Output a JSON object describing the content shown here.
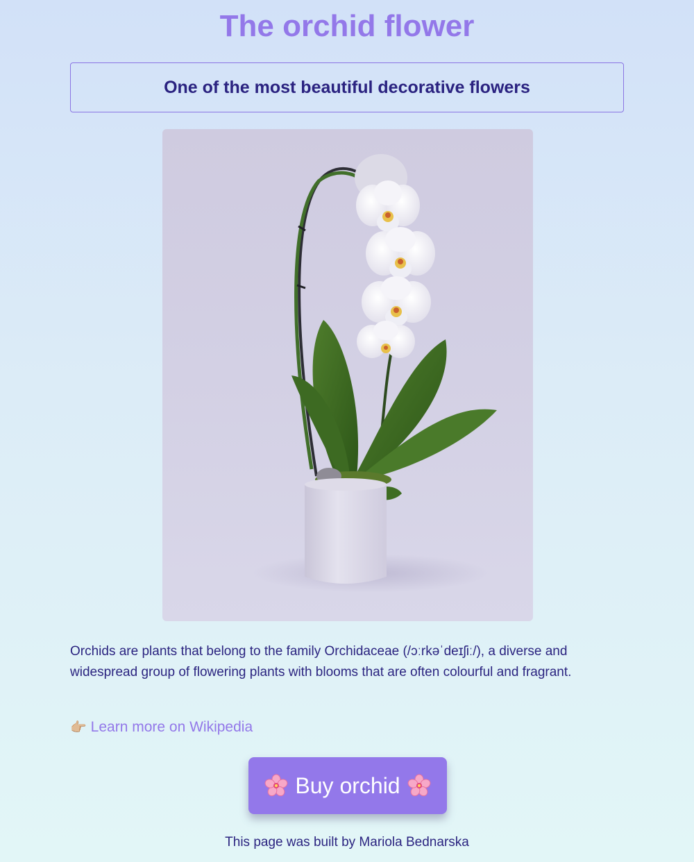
{
  "header": {
    "title": "The orchid flower",
    "subtitle": "One of the most beautiful decorative flowers"
  },
  "image": {
    "alt": "White orchid in a pot",
    "icon": "orchid-photo"
  },
  "main": {
    "description": "Orchids are plants that belong to the family Orchidaceae (/ɔːrkəˈdeɪʃiː/), a diverse and widespread group of flowering plants with blooms that are often colourful and fragrant.",
    "link_icon": "👉🏼",
    "link_label": "Learn more on Wikipedia",
    "buy_label": "Buy orchid"
  },
  "footer": {
    "text": "This page was built by Mariola Bednarska"
  },
  "colors": {
    "accent": "#9378e9",
    "text": "#2b2480",
    "button": "#9378ea"
  }
}
